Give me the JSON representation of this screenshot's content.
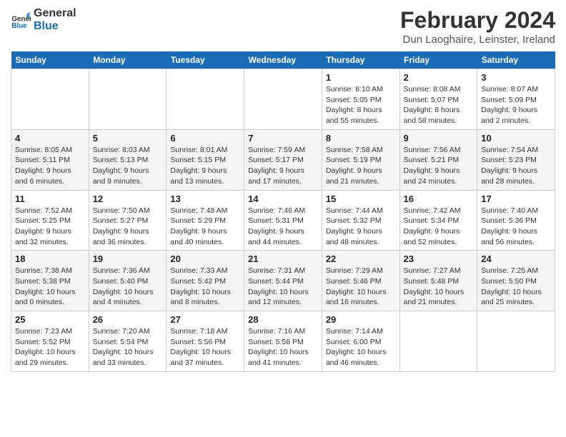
{
  "header": {
    "logo_line1": "General",
    "logo_line2": "Blue",
    "main_title": "February 2024",
    "subtitle": "Dun Laoghaire, Leinster, Ireland"
  },
  "days_of_week": [
    "Sunday",
    "Monday",
    "Tuesday",
    "Wednesday",
    "Thursday",
    "Friday",
    "Saturday"
  ],
  "weeks": [
    [
      {
        "day": "",
        "info": ""
      },
      {
        "day": "",
        "info": ""
      },
      {
        "day": "",
        "info": ""
      },
      {
        "day": "",
        "info": ""
      },
      {
        "day": "1",
        "info": "Sunrise: 8:10 AM\nSunset: 5:05 PM\nDaylight: 8 hours and 55 minutes."
      },
      {
        "day": "2",
        "info": "Sunrise: 8:08 AM\nSunset: 5:07 PM\nDaylight: 8 hours and 58 minutes."
      },
      {
        "day": "3",
        "info": "Sunrise: 8:07 AM\nSunset: 5:09 PM\nDaylight: 9 hours and 2 minutes."
      }
    ],
    [
      {
        "day": "4",
        "info": "Sunrise: 8:05 AM\nSunset: 5:11 PM\nDaylight: 9 hours and 6 minutes."
      },
      {
        "day": "5",
        "info": "Sunrise: 8:03 AM\nSunset: 5:13 PM\nDaylight: 9 hours and 9 minutes."
      },
      {
        "day": "6",
        "info": "Sunrise: 8:01 AM\nSunset: 5:15 PM\nDaylight: 9 hours and 13 minutes."
      },
      {
        "day": "7",
        "info": "Sunrise: 7:59 AM\nSunset: 5:17 PM\nDaylight: 9 hours and 17 minutes."
      },
      {
        "day": "8",
        "info": "Sunrise: 7:58 AM\nSunset: 5:19 PM\nDaylight: 9 hours and 21 minutes."
      },
      {
        "day": "9",
        "info": "Sunrise: 7:56 AM\nSunset: 5:21 PM\nDaylight: 9 hours and 24 minutes."
      },
      {
        "day": "10",
        "info": "Sunrise: 7:54 AM\nSunset: 5:23 PM\nDaylight: 9 hours and 28 minutes."
      }
    ],
    [
      {
        "day": "11",
        "info": "Sunrise: 7:52 AM\nSunset: 5:25 PM\nDaylight: 9 hours and 32 minutes."
      },
      {
        "day": "12",
        "info": "Sunrise: 7:50 AM\nSunset: 5:27 PM\nDaylight: 9 hours and 36 minutes."
      },
      {
        "day": "13",
        "info": "Sunrise: 7:48 AM\nSunset: 5:29 PM\nDaylight: 9 hours and 40 minutes."
      },
      {
        "day": "14",
        "info": "Sunrise: 7:46 AM\nSunset: 5:31 PM\nDaylight: 9 hours and 44 minutes."
      },
      {
        "day": "15",
        "info": "Sunrise: 7:44 AM\nSunset: 5:32 PM\nDaylight: 9 hours and 48 minutes."
      },
      {
        "day": "16",
        "info": "Sunrise: 7:42 AM\nSunset: 5:34 PM\nDaylight: 9 hours and 52 minutes."
      },
      {
        "day": "17",
        "info": "Sunrise: 7:40 AM\nSunset: 5:36 PM\nDaylight: 9 hours and 56 minutes."
      }
    ],
    [
      {
        "day": "18",
        "info": "Sunrise: 7:38 AM\nSunset: 5:38 PM\nDaylight: 10 hours and 0 minutes."
      },
      {
        "day": "19",
        "info": "Sunrise: 7:36 AM\nSunset: 5:40 PM\nDaylight: 10 hours and 4 minutes."
      },
      {
        "day": "20",
        "info": "Sunrise: 7:33 AM\nSunset: 5:42 PM\nDaylight: 10 hours and 8 minutes."
      },
      {
        "day": "21",
        "info": "Sunrise: 7:31 AM\nSunset: 5:44 PM\nDaylight: 10 hours and 12 minutes."
      },
      {
        "day": "22",
        "info": "Sunrise: 7:29 AM\nSunset: 5:46 PM\nDaylight: 10 hours and 16 minutes."
      },
      {
        "day": "23",
        "info": "Sunrise: 7:27 AM\nSunset: 5:48 PM\nDaylight: 10 hours and 21 minutes."
      },
      {
        "day": "24",
        "info": "Sunrise: 7:25 AM\nSunset: 5:50 PM\nDaylight: 10 hours and 25 minutes."
      }
    ],
    [
      {
        "day": "25",
        "info": "Sunrise: 7:23 AM\nSunset: 5:52 PM\nDaylight: 10 hours and 29 minutes."
      },
      {
        "day": "26",
        "info": "Sunrise: 7:20 AM\nSunset: 5:54 PM\nDaylight: 10 hours and 33 minutes."
      },
      {
        "day": "27",
        "info": "Sunrise: 7:18 AM\nSunset: 5:56 PM\nDaylight: 10 hours and 37 minutes."
      },
      {
        "day": "28",
        "info": "Sunrise: 7:16 AM\nSunset: 5:58 PM\nDaylight: 10 hours and 41 minutes."
      },
      {
        "day": "29",
        "info": "Sunrise: 7:14 AM\nSunset: 6:00 PM\nDaylight: 10 hours and 46 minutes."
      },
      {
        "day": "",
        "info": ""
      },
      {
        "day": "",
        "info": ""
      }
    ]
  ]
}
